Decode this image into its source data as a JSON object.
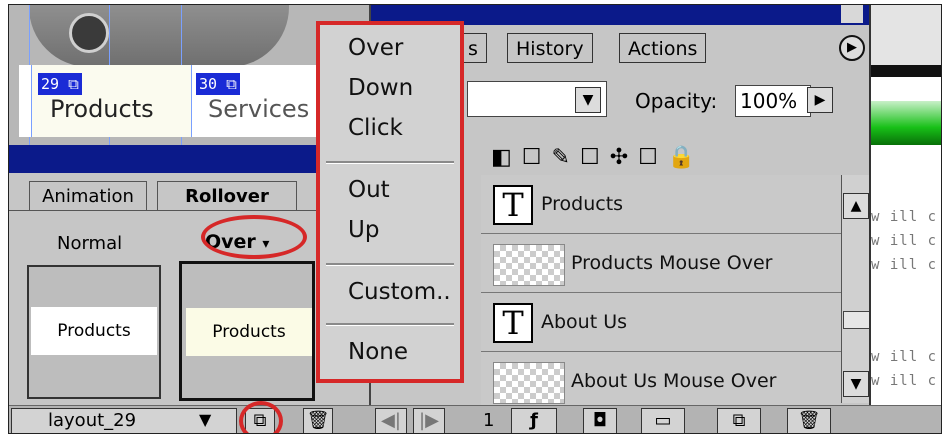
{
  "doc": {
    "slices": [
      {
        "number": "29",
        "label": "Products"
      },
      {
        "number": "30",
        "label": "Services"
      }
    ]
  },
  "rollover_palette": {
    "tabs": [
      "Animation",
      "Rollover"
    ],
    "normal_label": "Normal",
    "state_label": "Over",
    "state_caret": "▾",
    "normal_thumb_text": "Products",
    "over_thumb_text": "Products",
    "slice_select": "layout_29"
  },
  "state_menu": {
    "items": [
      "Over",
      "Down",
      "Click",
      "Out",
      "Up",
      "Custom..",
      "None"
    ]
  },
  "layers_palette": {
    "tabs": [
      "s",
      "History",
      "Actions"
    ],
    "opacity_label": "Opacity:",
    "opacity_value": "100%",
    "layers": [
      {
        "name": "Products",
        "thumb": "type"
      },
      {
        "name": "Products Mouse Over",
        "thumb": "checker"
      },
      {
        "name": "About Us",
        "thumb": "type"
      },
      {
        "name": "About Us Mouse Over",
        "thumb": "checker"
      }
    ],
    "frame_number": "1"
  },
  "right_panel": {
    "snippets": [
      "w ill c",
      "w ill c",
      "w ill c",
      "w ill c",
      "w ill c"
    ]
  },
  "colors": {
    "highlight_red": "#d62828",
    "title_navy": "#0b1a8a",
    "slice_blue": "#1a2bd6"
  }
}
